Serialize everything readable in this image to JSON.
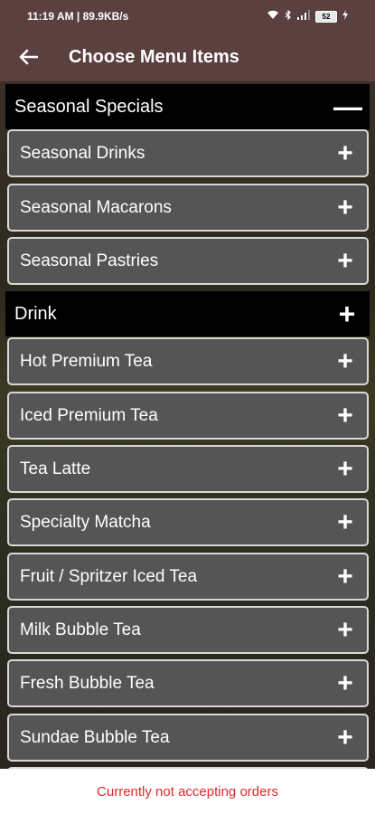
{
  "status_bar": {
    "time": "11:19 AM | 89.9KB/s",
    "battery": "52"
  },
  "header": {
    "back_icon": "arrow-left-icon",
    "title": "Choose Menu Items"
  },
  "sections": [
    {
      "label": "Seasonal Specials",
      "expanded": true,
      "toggle_symbol": "—",
      "items": [
        {
          "label": "Seasonal Drinks"
        },
        {
          "label": "Seasonal Macarons"
        },
        {
          "label": "Seasonal Pastries"
        }
      ]
    },
    {
      "label": "Drink",
      "expanded": true,
      "toggle_symbol": "+",
      "items": [
        {
          "label": "Hot Premium Tea"
        },
        {
          "label": "Iced Premium Tea"
        },
        {
          "label": "Tea Latte"
        },
        {
          "label": "Specialty Matcha"
        },
        {
          "label": "Fruit / Spritzer Iced Tea"
        },
        {
          "label": "Milk Bubble Tea"
        },
        {
          "label": "Fresh Bubble Tea"
        },
        {
          "label": "Sundae Bubble Tea"
        }
      ]
    }
  ],
  "item_action_symbol": "+",
  "footer": {
    "message": "Currently not accepting orders"
  },
  "colors": {
    "app_bar": "#5b4040",
    "section_header": "#000000",
    "item_bg": "#555555",
    "footer_text": "#e02828"
  }
}
